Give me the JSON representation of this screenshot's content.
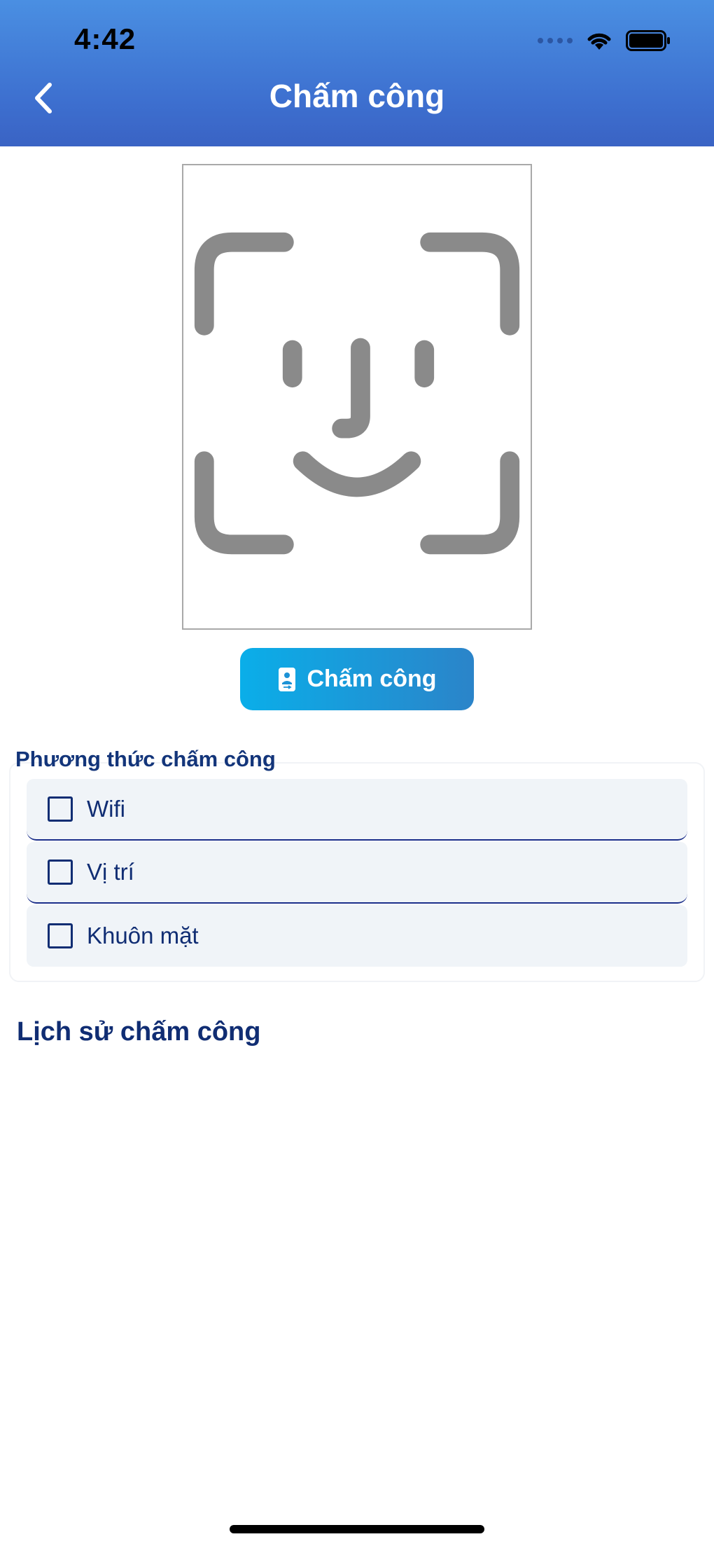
{
  "status_bar": {
    "time": "4:42"
  },
  "header": {
    "title": "Chấm công"
  },
  "checkin_button": {
    "label": "Chấm công"
  },
  "methods": {
    "label": "Phương thức chấm công",
    "items": [
      {
        "label": "Wifi",
        "checked": false
      },
      {
        "label": "Vị trí",
        "checked": false
      },
      {
        "label": "Khuôn mặt",
        "checked": false
      }
    ]
  },
  "history": {
    "title": "Lịch sử chấm công"
  },
  "colors": {
    "header_gradient_top": "#4a8fe2",
    "header_gradient_bottom": "#3a63c4",
    "button_gradient_start": "#0aaee9",
    "button_gradient_end": "#2b84c9",
    "text_dark_blue": "#102d73",
    "face_icon": "#8a8a8a"
  }
}
